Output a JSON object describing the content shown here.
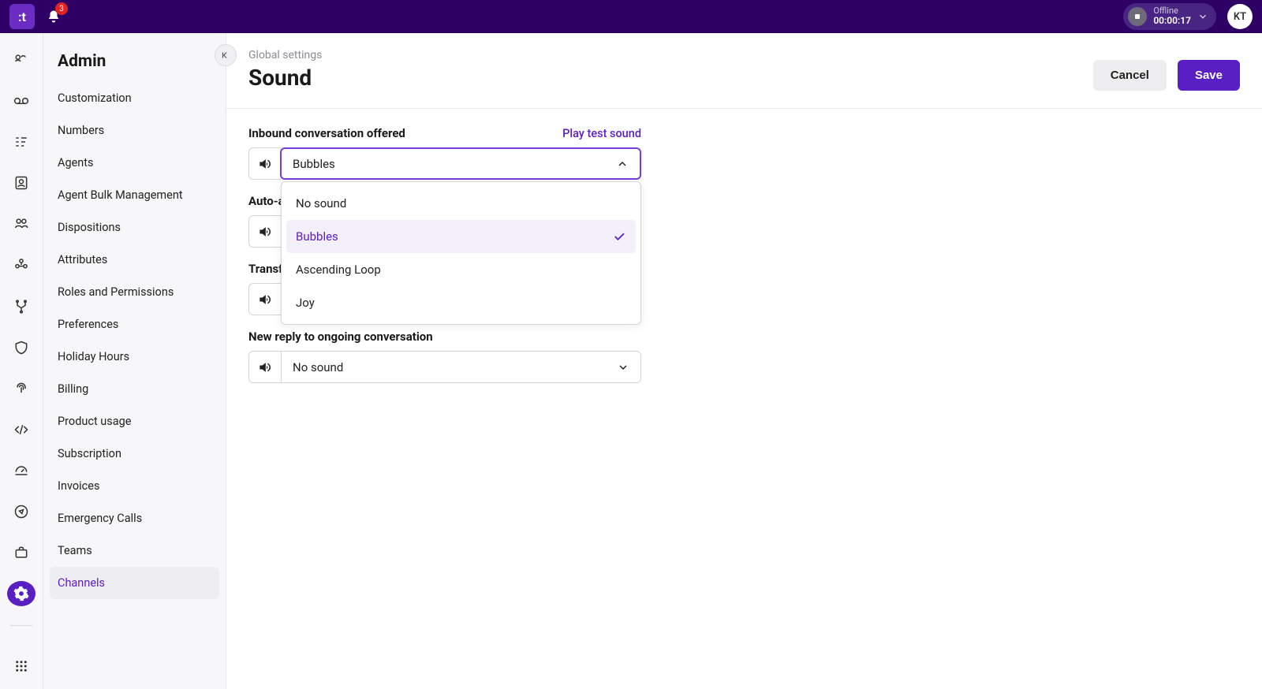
{
  "header": {
    "logo_text": ":t",
    "notification_count": "3",
    "status_label": "Offline",
    "status_timer": "00:00:17",
    "avatar_initials": "KT"
  },
  "sidebar": {
    "title": "Admin",
    "items": [
      {
        "label": "Customization"
      },
      {
        "label": "Numbers"
      },
      {
        "label": "Agents"
      },
      {
        "label": "Agent Bulk Management"
      },
      {
        "label": "Dispositions"
      },
      {
        "label": "Attributes"
      },
      {
        "label": "Roles and Permissions"
      },
      {
        "label": "Preferences"
      },
      {
        "label": "Holiday Hours"
      },
      {
        "label": "Billing"
      },
      {
        "label": "Product usage"
      },
      {
        "label": "Subscription"
      },
      {
        "label": "Invoices"
      },
      {
        "label": "Emergency Calls"
      },
      {
        "label": "Teams"
      },
      {
        "label": "Channels"
      }
    ],
    "active_index": 15
  },
  "main": {
    "breadcrumb": "Global settings",
    "title": "Sound",
    "cancel_label": "Cancel",
    "save_label": "Save",
    "play_test_label": "Play test sound",
    "settings": [
      {
        "label": "Inbound conversation offered",
        "value": "Bubbles",
        "open": true
      },
      {
        "label": "Auto-a",
        "value": "",
        "open": false,
        "hidden_value": true
      },
      {
        "label": "Transf",
        "value": "",
        "open": false,
        "hidden_value": true
      },
      {
        "label": "New reply to ongoing conversation",
        "value": "No sound",
        "open": false
      }
    ],
    "dropdown_options": [
      "No sound",
      "Bubbles",
      "Ascending Loop",
      "Joy"
    ],
    "dropdown_selected": "Bubbles"
  }
}
